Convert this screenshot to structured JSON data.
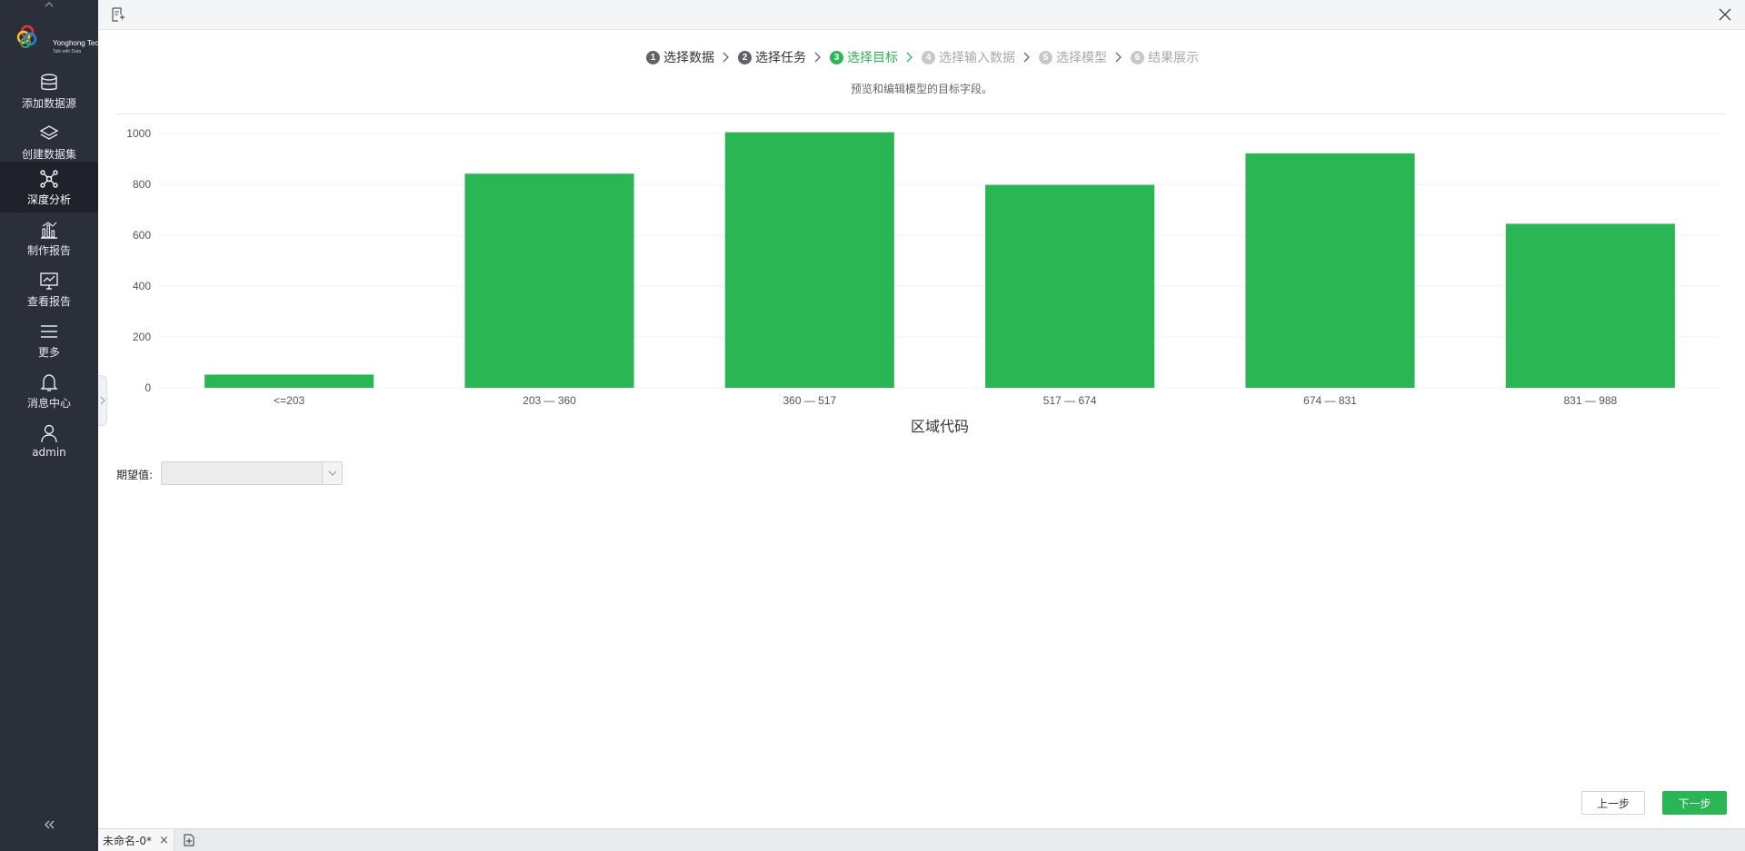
{
  "app": {
    "logo_name": "Yonghong Tech",
    "logo_slogan": "Talk with Data"
  },
  "sidebar": {
    "items": [
      {
        "label": "添加数据源",
        "icon": "database-icon"
      },
      {
        "label": "创建数据集",
        "icon": "layers-icon"
      },
      {
        "label": "深度分析",
        "icon": "network-icon",
        "active": true
      },
      {
        "label": "制作报告",
        "icon": "bar-chart-icon"
      },
      {
        "label": "查看报告",
        "icon": "monitor-chart-icon"
      },
      {
        "label": "更多",
        "icon": "menu-icon"
      },
      {
        "label": "消息中心",
        "icon": "bell-icon"
      },
      {
        "label": "admin",
        "icon": "user-icon"
      }
    ]
  },
  "stepper": {
    "steps": [
      {
        "num": "1",
        "label": "选择数据",
        "state": "done"
      },
      {
        "num": "2",
        "label": "选择任务",
        "state": "done"
      },
      {
        "num": "3",
        "label": "选择目标",
        "state": "active"
      },
      {
        "num": "4",
        "label": "选择输入数据",
        "state": "todo"
      },
      {
        "num": "5",
        "label": "选择模型",
        "state": "todo"
      },
      {
        "num": "6",
        "label": "结果展示",
        "state": "todo"
      }
    ],
    "subtitle": "预览和编辑模型的目标字段。"
  },
  "chart_data": {
    "type": "bar",
    "categories": [
      "<=203",
      "203 — 360",
      "360 — 517",
      "517 — 674",
      "674 — 831",
      "831 — 988"
    ],
    "values": [
      52,
      842,
      1005,
      798,
      922,
      645
    ],
    "xlabel": "区域代码",
    "ylabel": "",
    "ylim": [
      0,
      1000
    ],
    "yticks": [
      0,
      200,
      400,
      600,
      800,
      1000
    ],
    "grid": true,
    "bar_color": "#2bb656"
  },
  "form": {
    "expected_label": "期望值:",
    "expected_value": ""
  },
  "buttons": {
    "prev": "上一步",
    "next": "下一步"
  },
  "tabs": {
    "doc_name": "未命名-0*",
    "close": "×"
  }
}
